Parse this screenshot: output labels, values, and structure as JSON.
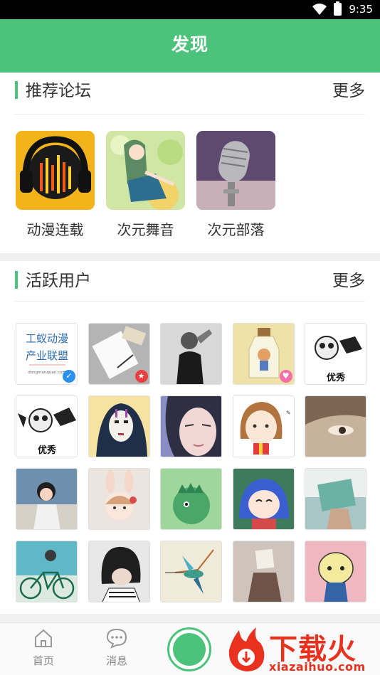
{
  "status": {
    "time": "9:35"
  },
  "header": {
    "title": "发现"
  },
  "forums_section": {
    "title": "推荐论坛",
    "more": "更多",
    "items": [
      {
        "label": "动漫连载"
      },
      {
        "label": "次元舞音"
      },
      {
        "label": "次元部落"
      }
    ]
  },
  "users_section": {
    "title": "活跃用户",
    "more": "更多",
    "first_avatar": {
      "line1": "工蚁动漫",
      "line2": "产业联盟",
      "line3": "dongmanquan.com"
    },
    "panda_caption": "优秀"
  },
  "tabbar": {
    "home": "首页",
    "messages": "消息"
  },
  "watermark": {
    "text": "下载火",
    "sub": "xiazaihuo.com"
  },
  "colors": {
    "accent": "#4cc37a"
  }
}
